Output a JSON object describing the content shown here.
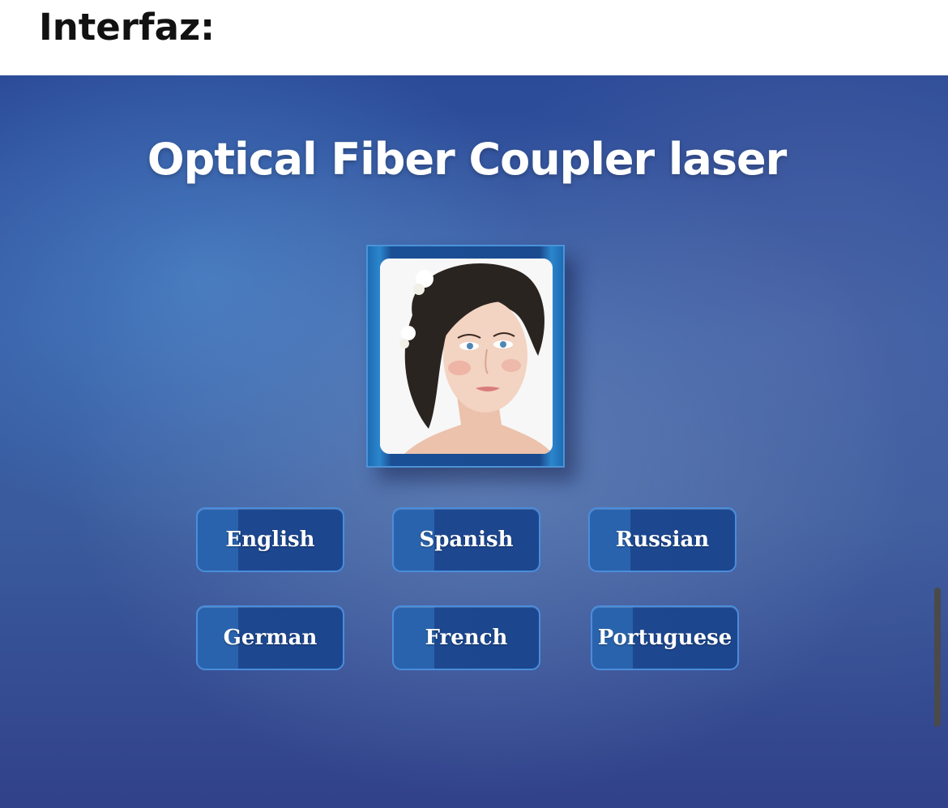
{
  "heading": "Interfaz:",
  "app": {
    "title": "Optical Fiber Coupler laser",
    "languages": [
      {
        "label": "English"
      },
      {
        "label": "Spanish"
      },
      {
        "label": "Russian"
      },
      {
        "label": "German"
      },
      {
        "label": "French"
      },
      {
        "label": "Portuguese"
      }
    ]
  },
  "colors": {
    "background": "#3a5c9e",
    "button_fill": "#1d4890",
    "button_border": "#4a8ddc",
    "title_text": "#ffffff"
  }
}
